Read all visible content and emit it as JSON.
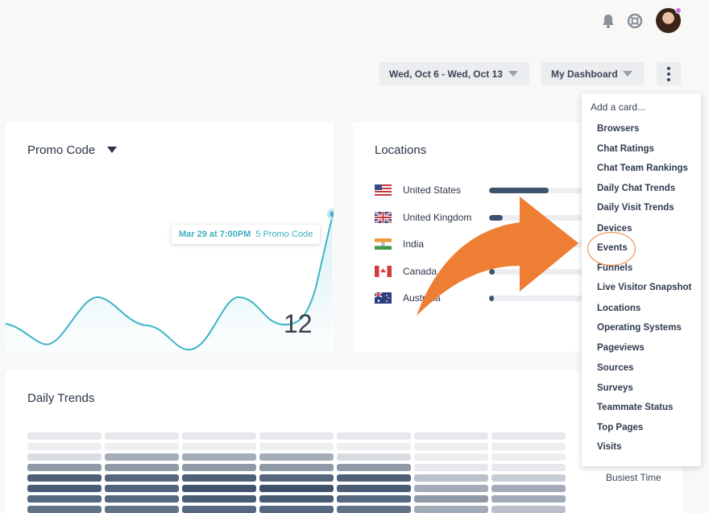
{
  "header": {
    "icons": [
      "bell-icon",
      "help-icon",
      "avatar"
    ],
    "date_range": "Wed, Oct 6 - Wed, Oct 13",
    "dashboard": "My Dashboard",
    "more_icon": "vertical-dots-icon"
  },
  "promo": {
    "title": "Promo Code",
    "tooltip_time": "Mar 29 at 7:00PM",
    "tooltip_count": "5 Promo Code",
    "big_number": "12",
    "line_color": "#3db4c6"
  },
  "locations": {
    "title": "Locations",
    "rows": [
      {
        "name": "United States",
        "flag": "us-flag-icon",
        "share": 0.62
      },
      {
        "name": "United Kingdom",
        "flag": "uk-flag-icon",
        "share": 0.14
      },
      {
        "name": "India",
        "flag": "india-flag-icon",
        "share": 0.08
      },
      {
        "name": "Canada",
        "flag": "canada-flag-icon",
        "share": 0.06
      },
      {
        "name": "Australia",
        "flag": "australia-flag-icon",
        "share": 0.05
      }
    ]
  },
  "trends": {
    "title": "Daily Trends",
    "busiest_label": "Busiest Time"
  },
  "menu": {
    "heading": "Add a card...",
    "items": [
      "Browsers",
      "Chat Ratings",
      "Chat Team Rankings",
      "Daily Chat Trends",
      "Daily Visit Trends",
      "Devices",
      "Events",
      "Funnels",
      "Live Visitor Snapshot",
      "Locations",
      "Operating Systems",
      "Pageviews",
      "Sources",
      "Surveys",
      "Teammate Status",
      "Top Pages",
      "Visits"
    ],
    "highlighted": "Events"
  },
  "colors": {
    "accent_orange": "#ef7e35",
    "chart_teal": "#3db4c6",
    "bar_navy": "#3e536e"
  }
}
